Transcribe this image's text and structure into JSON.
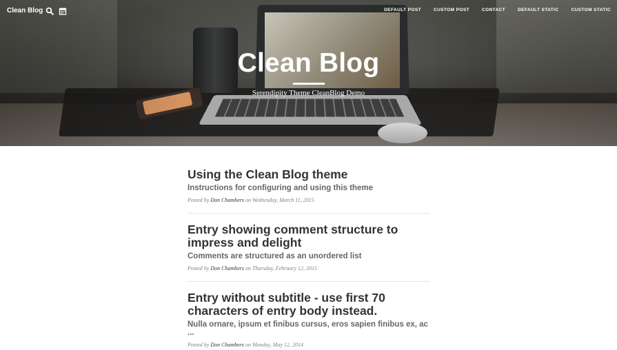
{
  "navbar": {
    "brand": "Clean Blog",
    "links": [
      "DEFAULT POST",
      "CUSTOM POST",
      "CONTACT",
      "DEFAULT STATIC",
      "CUSTOM STATIC"
    ]
  },
  "header": {
    "title": "Clean Blog",
    "subtitle": "Serendipity Theme CleanBlog Demo"
  },
  "posts": [
    {
      "title": "Using the Clean Blog theme",
      "subtitle": "Instructions for configuring and using this theme",
      "posted_by": "Posted by",
      "author": "Don Chambers",
      "on": "on",
      "date": "Wednesday, March 11, 2015"
    },
    {
      "title": "Entry showing comment structure to impress and delight",
      "subtitle": "Comments are structured as an unordered list",
      "posted_by": "Posted by",
      "author": "Don Chambers",
      "on": "on",
      "date": "Thursday, February 12, 2015"
    },
    {
      "title": "Entry without subtitle - use first 70 characters of entry body instead.",
      "subtitle": "Nulla ornare, ipsum et finibus cursus, eros sapien finibus ex, ac ...",
      "posted_by": "Posted by",
      "author": "Don Chambers",
      "on": "on",
      "date": "Monday, May 12, 2014"
    }
  ]
}
